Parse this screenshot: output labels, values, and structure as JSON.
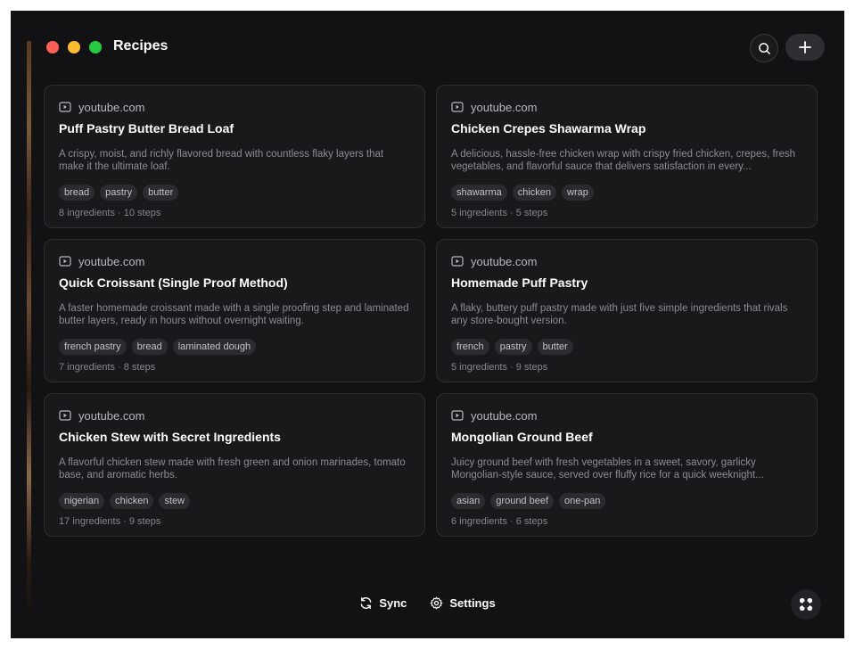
{
  "window": {
    "title": "Recipes"
  },
  "toolbar": {
    "search_icon": "search-icon",
    "add_icon": "plus-icon"
  },
  "recipes": [
    {
      "source": "youtube.com",
      "title": "Puff Pastry Butter Bread Loaf",
      "description": "A crispy, moist, and richly flavored bread with countless flaky layers that make it the ultimate loaf.",
      "tags": [
        "bread",
        "pastry",
        "butter"
      ],
      "meta": "8 ingredients · 10 steps"
    },
    {
      "source": "youtube.com",
      "title": "Chicken Crepes Shawarma Wrap",
      "description": "A delicious, hassle-free chicken wrap with crispy fried chicken, crepes, fresh vegetables, and flavorful sauce that delivers satisfaction in every...",
      "tags": [
        "shawarma",
        "chicken",
        "wrap"
      ],
      "meta": "5 ingredients · 5 steps"
    },
    {
      "source": "youtube.com",
      "title": "Quick Croissant (Single Proof Method)",
      "description": "A faster homemade croissant made with a single proofing step and laminated butter layers, ready in hours without overnight waiting.",
      "tags": [
        "french pastry",
        "bread",
        "laminated dough"
      ],
      "meta": "7 ingredients · 8 steps"
    },
    {
      "source": "youtube.com",
      "title": "Homemade Puff Pastry",
      "description": "A flaky, buttery puff pastry made with just five simple ingredients that rivals any store-bought version.",
      "tags": [
        "french",
        "pastry",
        "butter"
      ],
      "meta": "5 ingredients · 9 steps"
    },
    {
      "source": "youtube.com",
      "title": "Chicken Stew with Secret Ingredients",
      "description": "A flavorful chicken stew made with fresh green and onion marinades, tomato base, and aromatic herbs.",
      "tags": [
        "nigerian",
        "chicken",
        "stew"
      ],
      "meta": "17 ingredients · 9 steps"
    },
    {
      "source": "youtube.com",
      "title": "Mongolian Ground Beef",
      "description": "Juicy ground beef with fresh vegetables in a sweet, savory, garlicky Mongolian-style sauce, served over fluffy rice for a quick weeknight...",
      "tags": [
        "asian",
        "ground beef",
        "one-pan"
      ],
      "meta": "6 ingredients · 6 steps"
    }
  ],
  "footer": {
    "sync_label": "Sync",
    "settings_label": "Settings"
  },
  "colors": {
    "background": "#121215",
    "card": "#19191c",
    "tag": "#2c2c30"
  }
}
